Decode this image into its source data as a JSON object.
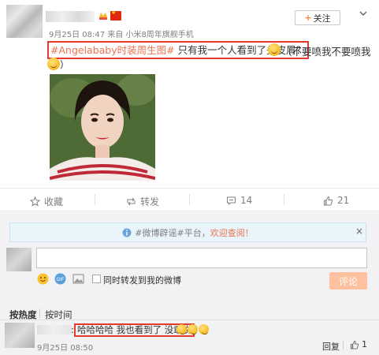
{
  "post": {
    "meta": "9月25日 08:47 来自 小米8周年旗舰手机",
    "follow_label": "关注",
    "topic": "#Angelababy时装周生图#",
    "text": " 只有我一个人看到了头皮屑？",
    "tail": "（不要喷我不要喷我",
    "tail_end": "）"
  },
  "actions": {
    "favorite": "收藏",
    "repost": "转发",
    "comment_count": "14",
    "like_count": "21"
  },
  "comment_area": {
    "notice_prefix": "#微博辟谣#平台，",
    "notice_link": "欢迎查阅！",
    "notice_close": "×",
    "repost_checkbox_label": "同时转发到我的微博",
    "submit_label": "评论"
  },
  "sort": {
    "hot": "按热度",
    "time": "按时间"
  },
  "reply": {
    "text": "哈哈哈哈 我也看到了 没敢说",
    "time": "9月25日 08:50",
    "reply_label": "回复",
    "like_count": "1"
  },
  "icons": [
    "badge-icon",
    "flag-icon",
    "chevron-down-icon",
    "star-icon",
    "repost-icon",
    "comment-icon",
    "like-icon",
    "emoji-icon",
    "gif-icon",
    "image-icon",
    "topic-icon"
  ],
  "colors": {
    "topic": "#eb7350",
    "highlight_box": "#e23b2e",
    "submit_disabled": "#ffc09f"
  }
}
